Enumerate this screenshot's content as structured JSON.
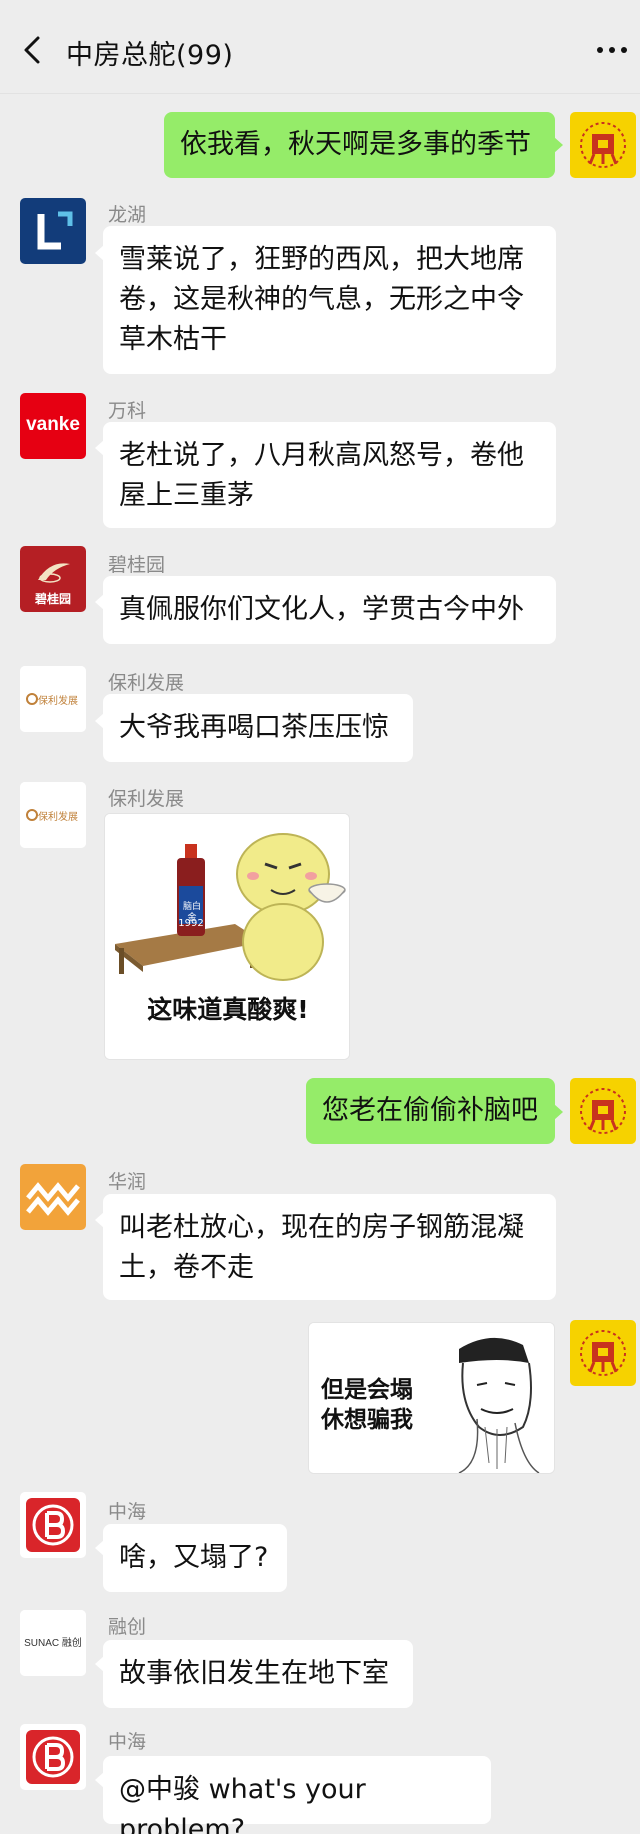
{
  "header": {
    "title": "中房总舵(99)"
  },
  "messages": [
    {
      "side": "out",
      "text": "依我看，秋天啊是多事的季节"
    },
    {
      "side": "in",
      "sender": "龙湖",
      "text": "雪莱说了，狂野的西风，把大地席\n卷，这是秋神的气息，无形之中令\n草木枯干"
    },
    {
      "side": "in",
      "sender": "万科",
      "text": "老杜说了，八月秋高风怒号，卷他\n屋上三重茅"
    },
    {
      "side": "in",
      "sender": "碧桂园",
      "text": "真佩服你们文化人，学贯古今中外"
    },
    {
      "side": "in",
      "sender": "保利发展",
      "text": "大爷我再喝口茶压压惊"
    },
    {
      "side": "in",
      "sender": "保利发展",
      "sticker_caption": "这味道真酸爽!",
      "bottle_label": "脑白金",
      "bottle_year": "1992"
    },
    {
      "side": "out",
      "text": "您老在偷偷补脑吧"
    },
    {
      "side": "in",
      "sender": "华润",
      "text": "叫老杜放心，现在的房子钢筋混凝\n土，卷不走"
    },
    {
      "side": "out",
      "sticker_caption": "但是会塌\n休想骗我"
    },
    {
      "side": "in",
      "sender": "中海",
      "text": "啥，又塌了?"
    },
    {
      "side": "in",
      "sender": "融创",
      "text": "故事依旧发生在地下室"
    },
    {
      "side": "in",
      "sender": "中海",
      "text": "@中骏 what's your problem?"
    }
  ],
  "avatars": {
    "vanke_text": "vanke",
    "bgy_text": "碧桂园",
    "poly_text": "保利发展",
    "sunac_text": "SUNAC 融创"
  },
  "colors": {
    "background": "#ededed",
    "bubble_in": "#ffffff",
    "bubble_out": "#95ec69",
    "longfor": "#123c7a",
    "vanke": "#e60012",
    "bgy": "#b51f24",
    "cr": "#f2a33a",
    "coli": "#d9252a"
  }
}
